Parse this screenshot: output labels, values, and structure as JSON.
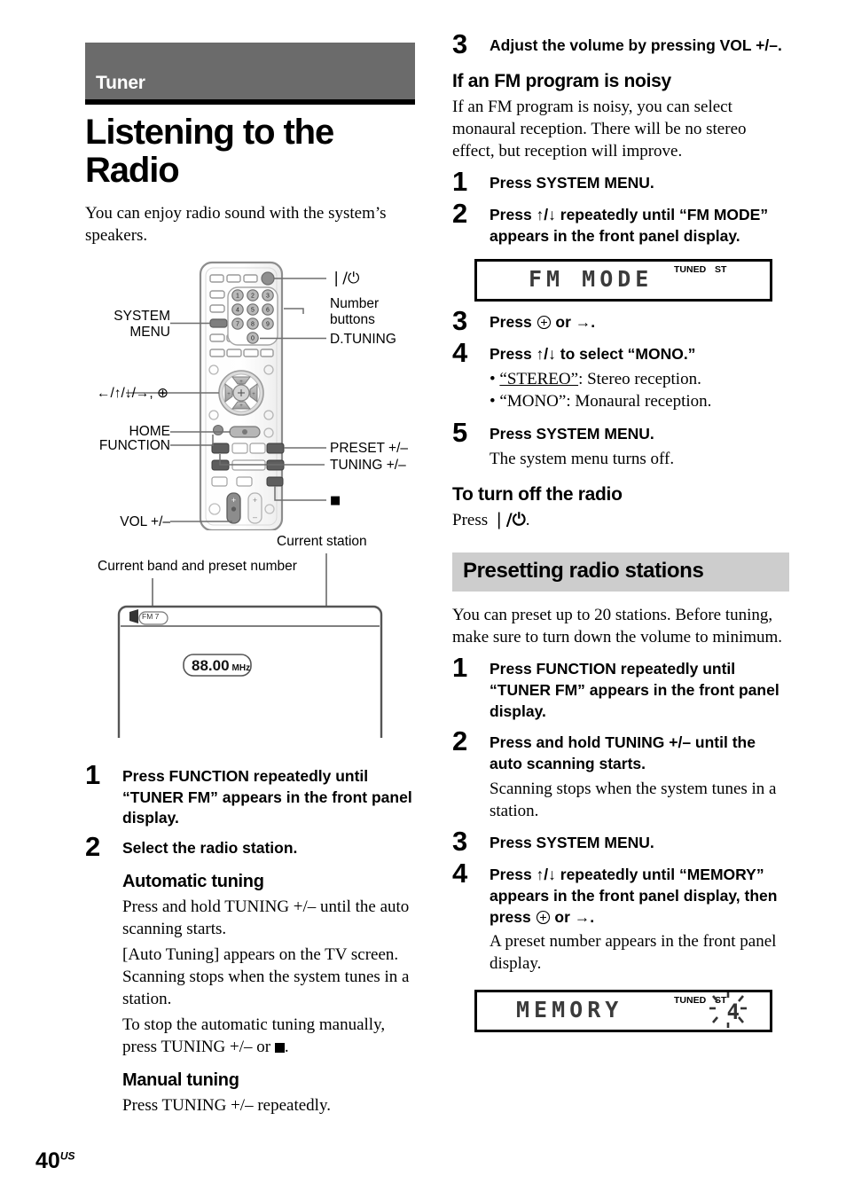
{
  "page": {
    "number": "40",
    "region_suffix": "US",
    "chapter": "Tuner",
    "title": "Listening to the Radio",
    "intro": "You can enjoy radio sound with the system’s speakers."
  },
  "colors": {
    "chapter_band": "#6b6b6b",
    "chapter_rule": "#000000",
    "section_head_bg": "#cdcdcd",
    "text": "#000000"
  },
  "remote_figure": {
    "labels_left": [
      {
        "name": "system-menu",
        "line1": "SYSTEM",
        "line2": "MENU"
      },
      {
        "name": "cursor-enter",
        "line1": "←/↑/↓/→, ⊕",
        "line2": ""
      },
      {
        "name": "home",
        "line1": "HOME",
        "line2": ""
      },
      {
        "name": "function",
        "line1": "FUNCTION",
        "line2": ""
      },
      {
        "name": "vol",
        "line1": "VOL +/–",
        "line2": ""
      }
    ],
    "labels_right": [
      {
        "name": "power",
        "line1": "❘/⏻",
        "line2": ""
      },
      {
        "name": "number-buttons",
        "line1": "Number",
        "line2": "buttons"
      },
      {
        "name": "d-tuning",
        "line1": "D.TUNING",
        "line2": ""
      },
      {
        "name": "preset",
        "line1": "PRESET +/–",
        "line2": ""
      },
      {
        "name": "tuning",
        "line1": "TUNING +/–",
        "line2": ""
      },
      {
        "name": "stop",
        "line1": "■",
        "line2": ""
      }
    ],
    "keypad_digits": [
      "1",
      "2",
      "3",
      "4",
      "5",
      "6",
      "7",
      "8",
      "9",
      "0"
    ]
  },
  "tv_figure": {
    "callout_station": "Current station",
    "callout_band": "Current band and preset number",
    "band_chip": "FM 7",
    "frequency": "88.00",
    "frequency_unit": "MHz"
  },
  "left_column": {
    "steps": [
      {
        "num": "1",
        "text": "Press FUNCTION repeatedly until “TUNER FM” appears in the front panel display."
      },
      {
        "num": "2",
        "text": "Select the radio station."
      }
    ],
    "automatic_tuning": {
      "heading": "Automatic tuning",
      "p1": "Press and hold TUNING +/– until the auto scanning starts.",
      "p2": "[Auto Tuning] appears on the TV screen. Scanning stops when the system tunes in a station.",
      "p3_a": "To stop the automatic tuning manually, press TUNING +/– or ",
      "p3_b": "."
    },
    "manual_tuning": {
      "heading": "Manual tuning",
      "p1": "Press TUNING +/– repeatedly."
    }
  },
  "right_column": {
    "step3_top": {
      "num": "3",
      "text": "Adjust the volume by pressing VOL +/–."
    },
    "noisy_section": {
      "heading": "If an FM program is noisy",
      "intro": "If an FM program is noisy, you can select monaural reception. There will be no stereo effect, but reception will improve.",
      "steps": [
        {
          "num": "1",
          "text": "Press SYSTEM MENU.",
          "sub": ""
        },
        {
          "num": "2",
          "text": "Press ↑/↓ repeatedly until “FM MODE” appears in the front panel display.",
          "sub": ""
        },
        {
          "num": "3",
          "text_a": "Press ",
          "text_b": " or →.",
          "sub": ""
        },
        {
          "num": "4",
          "text": "Press ↑/↓ to select “MONO.”",
          "sub": ""
        },
        {
          "num": "5",
          "text": "Press SYSTEM MENU.",
          "sub": "The system menu turns off."
        }
      ],
      "bullets": [
        {
          "quoted": "“STEREO”",
          "rest": ": Stereo reception.",
          "underline": true
        },
        {
          "quoted": "“MONO”",
          "rest": ": Monaural reception.",
          "underline": false
        }
      ],
      "fm_mode_display": {
        "text": "FM MODE",
        "indicator_tuned": "TUNED",
        "indicator_st": "ST"
      }
    },
    "turn_off": {
      "heading": "To turn off the radio",
      "text_a": "Press ",
      "text_b": "."
    },
    "presetting": {
      "heading": "Presetting radio stations",
      "intro": "You can preset up to 20 stations. Before tuning, make sure to turn down the volume to minimum.",
      "steps": [
        {
          "num": "1",
          "text": "Press FUNCTION repeatedly until “TUNER FM” appears in the front panel display.",
          "sub": ""
        },
        {
          "num": "2",
          "text": "Press and hold TUNING +/– until the auto scanning starts.",
          "sub": "Scanning stops when the system tunes in a station."
        },
        {
          "num": "3",
          "text": "Press SYSTEM MENU.",
          "sub": ""
        },
        {
          "num": "4",
          "text_a": "Press ↑/↓ repeatedly until “MEMORY” appears in the front panel display, then press ",
          "text_b": " or →.",
          "sub": "A preset number appears in the front panel display."
        }
      ],
      "memory_display": {
        "text": "MEMORY",
        "indicator_tuned": "TUNED",
        "indicator_st": "ST",
        "preset_digit": "4",
        "blinking": true
      }
    }
  }
}
